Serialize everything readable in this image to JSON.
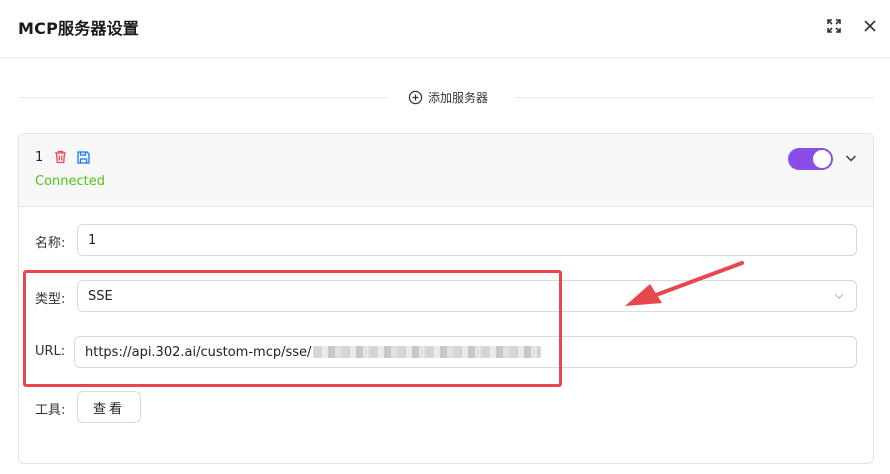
{
  "dialog": {
    "title": "MCP服务器设置",
    "maximize_icon": "maximize-icon",
    "close_icon": "close-icon"
  },
  "toolbar": {
    "add_server_label": "添加服务器",
    "add_icon": "plus-circle-icon"
  },
  "server": {
    "name": "1",
    "status": "Connected",
    "enabled": true,
    "delete_icon": "trash-icon",
    "save_icon": "save-icon",
    "collapse_icon": "chevron-down-icon",
    "fields": {
      "name_label": "名称:",
      "name_value": "1",
      "type_label": "类型:",
      "type_value": "SSE",
      "url_label": "URL:",
      "url_value": "https://api.302.ai/custom-mcp/sse/",
      "tools_label": "工具:",
      "tools_button": "查看"
    }
  },
  "colors": {
    "status_green": "#52c41a",
    "toggle_purple": "#8b4de8",
    "delete_red": "#e8474e",
    "save_blue": "#1677ff",
    "annotation_red": "#e8474e"
  }
}
